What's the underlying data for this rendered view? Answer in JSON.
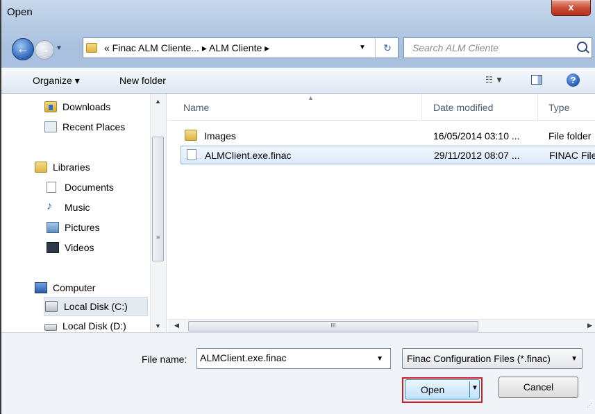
{
  "window": {
    "title": "Open",
    "close_label": "x"
  },
  "nav": {
    "back_label": "←",
    "forward_label": "→",
    "address": "« Finac ALM Cliente...  ▸  ALM Cliente  ▸",
    "search_placeholder": "Search ALM Cliente"
  },
  "toolbar": {
    "organize": "Organize ▾",
    "new_folder": "New folder"
  },
  "sidebar": {
    "items": [
      {
        "label": "Downloads",
        "icon": "downloads-folder-icon"
      },
      {
        "label": "Recent Places",
        "icon": "recent-places-icon"
      },
      {
        "label": "Libraries",
        "icon": "libraries-icon"
      },
      {
        "label": "Documents",
        "icon": "documents-icon"
      },
      {
        "label": "Music",
        "icon": "music-icon"
      },
      {
        "label": "Pictures",
        "icon": "pictures-icon"
      },
      {
        "label": "Videos",
        "icon": "videos-icon"
      },
      {
        "label": "Computer",
        "icon": "computer-icon"
      },
      {
        "label": "Local Disk (C:)",
        "icon": "local-disk-icon"
      },
      {
        "label": "Local Disk (D:)",
        "icon": "drive-icon"
      }
    ]
  },
  "files": {
    "columns": [
      "Name",
      "Date modified",
      "Type"
    ],
    "rows": [
      {
        "name": "Images",
        "date": "16/05/2014 03:10 ...",
        "type": "File folder",
        "icon": "folder-icon"
      },
      {
        "name": "ALMClient.exe.finac",
        "date": "29/11/2012 08:07 ...",
        "type": "FINAC File",
        "icon": "file-icon"
      }
    ]
  },
  "footer": {
    "file_name_label": "File name:",
    "file_name_value": "ALMClient.exe.finac",
    "filter": "Finac Configuration Files (*.finac)",
    "open_label": "Open",
    "cancel_label": "Cancel"
  },
  "colors": {
    "highlight_border": "#d31a22",
    "selected_row": "#dbe9fb",
    "accent": "#3c7fb1"
  }
}
